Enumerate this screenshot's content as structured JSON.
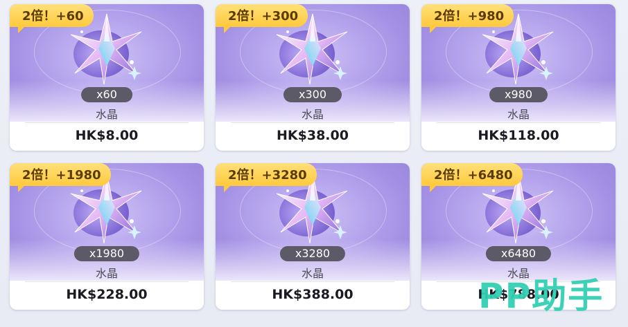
{
  "products": [
    {
      "badge": "2倍！+60",
      "quantity": "x60",
      "name": "水晶",
      "price": "HK$8.00"
    },
    {
      "badge": "2倍！+300",
      "quantity": "x300",
      "name": "水晶",
      "price": "HK$38.00"
    },
    {
      "badge": "2倍！+980",
      "quantity": "x980",
      "name": "水晶",
      "price": "HK$118.00"
    },
    {
      "badge": "2倍！+1980",
      "quantity": "x1980",
      "name": "水晶",
      "price": "HK$228.00"
    },
    {
      "badge": "2倍！+3280",
      "quantity": "x3280",
      "name": "水晶",
      "price": "HK$388.00"
    },
    {
      "badge": "2倍！+6480",
      "quantity": "x6480",
      "name": "水晶",
      "price": "HK$788.00"
    }
  ],
  "watermark": "PP助手",
  "colors": {
    "badge": "#ffc93c",
    "accent": "#a390e4",
    "watermark": "#33d0b4"
  },
  "icons": {
    "product_image": "crystal-icon"
  }
}
